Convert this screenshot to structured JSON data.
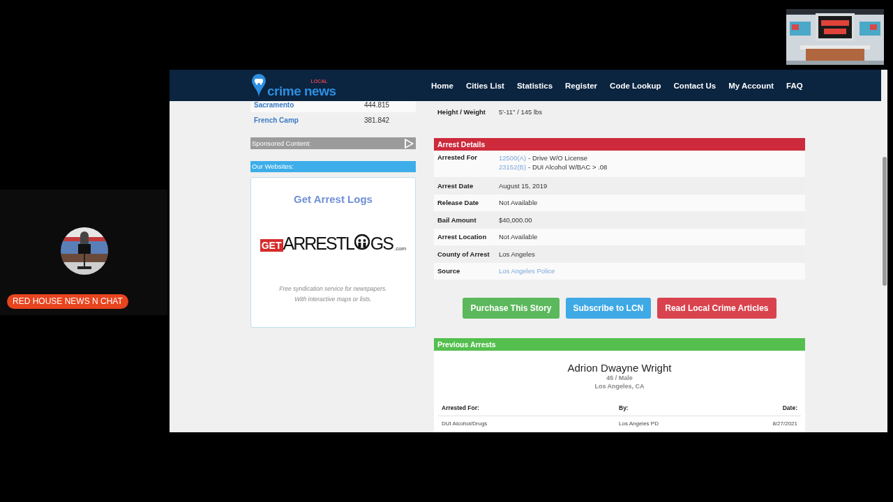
{
  "overlay": {
    "channel_name": "RED HOUSE NEWS N CHAT"
  },
  "site": {
    "logo": {
      "small": "LOCAL",
      "main": "crime news"
    },
    "nav": [
      "Home",
      "Cities List",
      "Statistics",
      "Register",
      "Code Lookup",
      "Contact Us",
      "My Account",
      "FAQ"
    ]
  },
  "sidebar": {
    "cities": [
      {
        "name": "Sacramento",
        "value": "444.815"
      },
      {
        "name": "French Camp",
        "value": "381.842"
      }
    ],
    "sponsored_label": "Sponsored Content:",
    "websites_label": "Our Websites:",
    "promo": {
      "title": "Get Arrest Logs",
      "logo": {
        "prefix": "GET",
        "main": "ARRESTL",
        "main_end": "GS",
        "suffix": ".com"
      },
      "caption_lines": [
        "Free syndication service for newspapers.",
        "With interactive maps or lists."
      ]
    }
  },
  "profile": {
    "rows": [
      {
        "label": "Height / Weight",
        "value": "5'-11\" / 145 lbs"
      }
    ]
  },
  "arrest_details": {
    "title": "Arrest Details",
    "rows": [
      {
        "kind": "charges",
        "label": "Arrested For",
        "charges": [
          {
            "code": "12500(A)",
            "description": "- Drive W/O License"
          },
          {
            "code": "23152(B)",
            "description": "- DUI Alcohol W/BAC > .08"
          }
        ]
      },
      {
        "kind": "text",
        "label": "Arrest Date",
        "value": "August 15, 2019"
      },
      {
        "kind": "text",
        "label": "Release Date",
        "value": "Not Available"
      },
      {
        "kind": "text",
        "label": "Bail Amount",
        "value": "$40,000.00"
      },
      {
        "kind": "text",
        "label": "Arrest Location",
        "value": "Not Available"
      },
      {
        "kind": "text",
        "label": "County of Arrest",
        "value": "Los Angeles"
      },
      {
        "kind": "link",
        "label": "Source",
        "value": "Los Angeles Police"
      }
    ]
  },
  "buttons": [
    {
      "label": "Purchase This Story",
      "color": "#5cb85c"
    },
    {
      "label": "Subscribe to LCN",
      "color": "#3fa9e6"
    },
    {
      "label": "Read Local Crime Articles",
      "color": "#d9434e"
    }
  ],
  "previous_arrests": {
    "title": "Previous Arrests",
    "name": "Adrion Dwayne Wright",
    "age_sex": "45 / Male",
    "location": "Los Angeles, CA",
    "columns": [
      "Arrested For:",
      "By:",
      "Date:"
    ],
    "rows": [
      [
        "DUI Alcohol/Drugs",
        "Los Angeles PD",
        "8/27/2021"
      ]
    ]
  }
}
